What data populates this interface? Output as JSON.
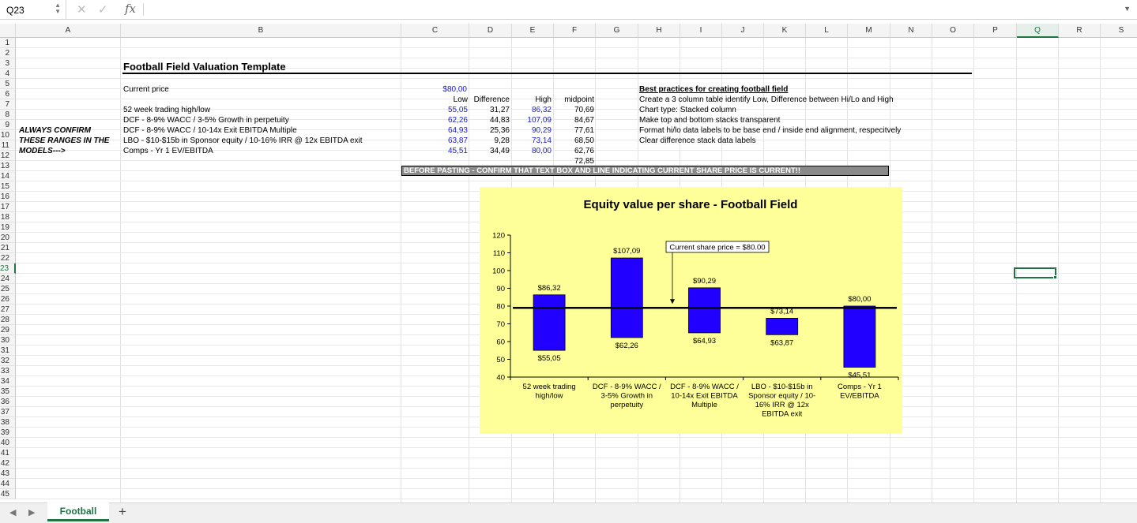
{
  "formula_bar": {
    "name_box": "Q23",
    "cancel_icon": "✕",
    "confirm_icon": "✓",
    "fx_label": "fx",
    "formula": ""
  },
  "columns": [
    "A",
    "B",
    "C",
    "D",
    "E",
    "F",
    "G",
    "H",
    "I",
    "J",
    "K",
    "L",
    "M",
    "N",
    "O",
    "P",
    "Q",
    "R",
    "S"
  ],
  "rows": [
    "1",
    "2",
    "3",
    "4",
    "5",
    "6",
    "7",
    "8",
    "9",
    "10",
    "11",
    "12",
    "13",
    "14",
    "15",
    "16",
    "17",
    "18",
    "19",
    "20",
    "21",
    "22",
    "23",
    "24",
    "25",
    "26",
    "27",
    "28",
    "29",
    "30",
    "31",
    "32",
    "33",
    "34",
    "35",
    "36",
    "37",
    "38",
    "39",
    "40",
    "41",
    "42",
    "43",
    "44",
    "45"
  ],
  "sheet": {
    "title": "Football Field Valuation Template",
    "current_price_label": "Current price",
    "current_price": "$80,00",
    "headers": {
      "low": "Low",
      "difference": "Difference",
      "high": "High",
      "midpoint": "midpoint"
    },
    "rows": [
      {
        "label": "52 week trading high/low",
        "low": "55,05",
        "difference": "31,27",
        "high": "86,32",
        "midpoint": "70,69"
      },
      {
        "label": "DCF - 8-9% WACC / 3-5% Growth in perpetuity",
        "low": "62,26",
        "difference": "44,83",
        "high": "107,09",
        "midpoint": "84,67"
      },
      {
        "label": "DCF - 8-9% WACC / 10-14x Exit EBITDA Multiple",
        "low": "64,93",
        "difference": "25,36",
        "high": "90,29",
        "midpoint": "77,61"
      },
      {
        "label": "LBO - $10-$15b in Sponsor equity / 10-16% IRR @ 12x EBITDA exit",
        "low": "63,87",
        "difference": "9,28",
        "high": "73,14",
        "midpoint": "68,50"
      },
      {
        "label": "Comps - Yr 1 EV/EBITDA",
        "low": "45,51",
        "difference": "34,49",
        "high": "80,00",
        "midpoint": "62,76"
      }
    ],
    "extra_midpoint": "72,85",
    "side_note": [
      "ALWAYS CONFIRM",
      "THESE RANGES IN THE",
      "MODELS--->"
    ],
    "best_practices_title": "Best practices for creating football field",
    "best_practices": [
      "Create a 3 column table identify Low, Difference between Hi/Lo and High",
      "Chart type: Stacked column",
      "Make top and bottom stacks transparent",
      "Format hi/lo data labels to be base end / inside end alignment, respecitvely",
      "Clear difference stack data labels"
    ],
    "warning": "BEFORE PASTING - CONFIRM THAT TEXT BOX AND LINE INDICATING CURRENT SHARE PRICE IS CURRENT!!"
  },
  "chart_data": {
    "type": "bar",
    "title": "Equity value per share - Football Field",
    "categories": [
      [
        "52 week trading",
        "high/low"
      ],
      [
        "DCF - 8-9% WACC /",
        "3-5% Growth in",
        "perpetuity"
      ],
      [
        "DCF - 8-9% WACC /",
        "10-14x Exit EBITDA",
        "Multiple"
      ],
      [
        "LBO - $10-$15b in",
        "Sponsor equity / 10-",
        "16% IRR @ 12x",
        "EBITDA exit"
      ],
      [
        "Comps - Yr 1",
        "EV/EBITDA"
      ]
    ],
    "low": [
      55.05,
      62.26,
      64.93,
      63.87,
      45.51
    ],
    "high": [
      86.32,
      107.09,
      90.29,
      73.14,
      80.0
    ],
    "low_labels": [
      "$55,05",
      "$62,26",
      "$64,93",
      "$63,87",
      "$45,51"
    ],
    "high_labels": [
      "$86,32",
      "$107,09",
      "$90,29",
      "$73,14",
      "$80,00"
    ],
    "ylim": [
      40,
      120
    ],
    "yticks": [
      40,
      50,
      60,
      70,
      80,
      90,
      100,
      110,
      120
    ],
    "current_price": 79,
    "annotation": "Current share price = $80.00",
    "bar_color": "#2200ff",
    "background": "#ffff99"
  },
  "tabs": {
    "prev_icon": "◀",
    "next_icon": "▶",
    "active": "Football",
    "add_icon": "+"
  }
}
